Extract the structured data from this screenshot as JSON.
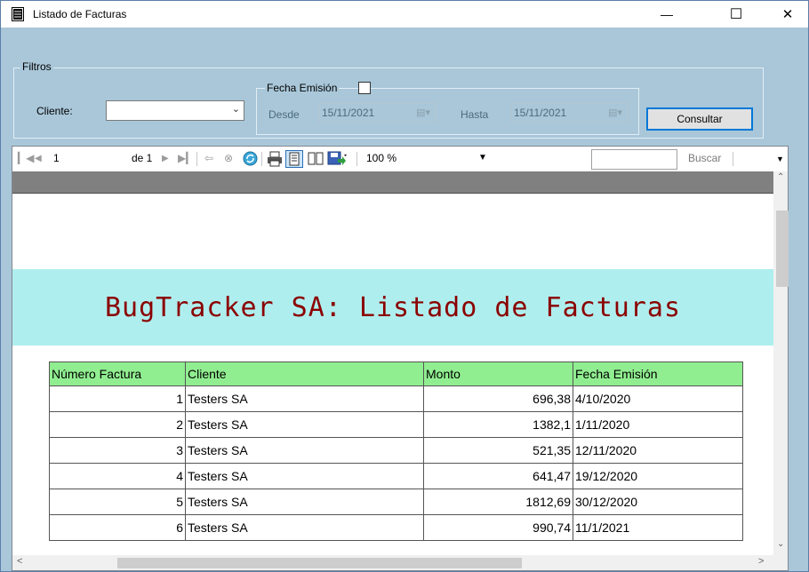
{
  "window": {
    "title": "Listado de Facturas",
    "minimize_glyph": "—",
    "maximize_glyph": "☐",
    "close_glyph": "✕"
  },
  "filters": {
    "group_label": "Filtros",
    "cliente_label": "Cliente:",
    "cliente_value": "",
    "fecha_group_label": "Fecha Emisión",
    "desde_label": "Desde",
    "desde_value": "15/11/2021",
    "hasta_label": "Hasta",
    "hasta_value": "15/11/2021",
    "consultar_label": "Consultar"
  },
  "toolbar": {
    "page_current": "1",
    "page_of": "de 1",
    "zoom": "100 %",
    "search_placeholder": "",
    "buscar_label": "Buscar",
    "icons": [
      "first-page-icon",
      "prev-page-icon",
      "next-page-icon",
      "last-page-icon",
      "back-icon",
      "stop-icon",
      "refresh-icon",
      "print-icon",
      "print-layout-icon",
      "page-setup-icon",
      "export-icon"
    ]
  },
  "report": {
    "title": "BugTracker SA: Listado de Facturas",
    "columns": [
      "Número Factura",
      "Cliente",
      "Monto",
      "Fecha Emisión"
    ],
    "rows": [
      [
        "1",
        "Testers SA",
        "696,38",
        "4/10/2020"
      ],
      [
        "2",
        "Testers SA",
        "1382,1",
        "1/11/2020"
      ],
      [
        "3",
        "Testers SA",
        "521,35",
        "12/11/2020"
      ],
      [
        "4",
        "Testers SA",
        "641,47",
        "19/12/2020"
      ],
      [
        "5",
        "Testers SA",
        "1812,69",
        "30/12/2020"
      ],
      [
        "6",
        "Testers SA",
        "990,74",
        "11/1/2021"
      ]
    ]
  },
  "colors": {
    "window_bg": "#a9c7d9",
    "title_band": "#afeeee",
    "title_text": "#8b0000",
    "header_bg": "#90ee90",
    "button_border": "#0078d7"
  }
}
